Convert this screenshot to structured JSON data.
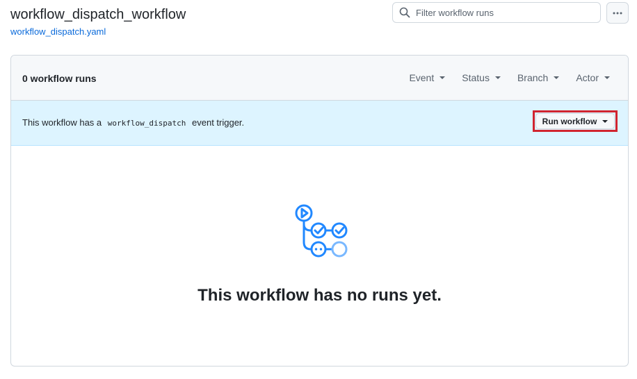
{
  "header": {
    "title": "workflow_dispatch_workflow",
    "file_link": "workflow_dispatch.yaml"
  },
  "search": {
    "placeholder": "Filter workflow runs",
    "value": ""
  },
  "runs": {
    "count_label": "0 workflow runs",
    "filters": [
      {
        "label": "Event"
      },
      {
        "label": "Status"
      },
      {
        "label": "Branch"
      },
      {
        "label": "Actor"
      }
    ]
  },
  "dispatch": {
    "text_before": "This workflow has a",
    "code": "workflow_dispatch",
    "text_after": "event trigger.",
    "button_label": "Run workflow"
  },
  "empty": {
    "title": "This workflow has no runs yet."
  },
  "colors": {
    "link": "#0969da",
    "banner_bg": "#ddf4ff",
    "highlight_border": "#d1242f",
    "illustration": "#2188ff",
    "illustration_light": "#79b8ff"
  },
  "icons": {
    "search": "search-icon",
    "more": "kebab-horizontal-icon",
    "empty": "workflow-graph-icon"
  }
}
